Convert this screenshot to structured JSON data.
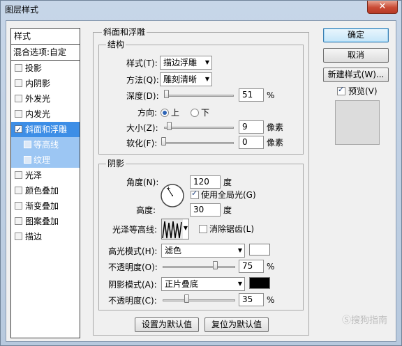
{
  "window": {
    "title": "图层样式",
    "close_glyph": "✕"
  },
  "style_list": {
    "header": "样式",
    "blend_options": "混合选项:自定",
    "items": [
      {
        "label": "投影",
        "checked": false
      },
      {
        "label": "内阴影",
        "checked": false
      },
      {
        "label": "外发光",
        "checked": false
      },
      {
        "label": "内发光",
        "checked": false
      },
      {
        "label": "斜面和浮雕",
        "checked": true,
        "selected": true
      },
      {
        "label": "等高线",
        "checked": false,
        "sub": true
      },
      {
        "label": "纹理",
        "checked": false,
        "sub": true
      },
      {
        "label": "光泽",
        "checked": false
      },
      {
        "label": "颜色叠加",
        "checked": false
      },
      {
        "label": "渐变叠加",
        "checked": false
      },
      {
        "label": "图案叠加",
        "checked": false
      },
      {
        "label": "描边",
        "checked": false
      }
    ]
  },
  "bevel": {
    "title": "斜面和浮雕",
    "structure": {
      "title": "结构",
      "style_label": "样式(T):",
      "style_value": "描边浮雕",
      "technique_label": "方法(Q):",
      "technique_value": "雕刻清晰",
      "depth_label": "深度(D):",
      "depth_value": "51",
      "depth_unit": "%",
      "depth_level": 0.051,
      "direction_label": "方向:",
      "direction_up": "上",
      "direction_down": "下",
      "direction_selected": "上",
      "size_label": "大小(Z):",
      "size_value": "9",
      "size_unit": "像素",
      "soften_label": "软化(F):",
      "soften_value": "0",
      "soften_unit": "像素"
    },
    "shading": {
      "title": "阴影",
      "angle_label": "角度(N):",
      "angle_value": "120",
      "angle_unit": "度",
      "global_light_label": "使用全局光(G)",
      "global_light_checked": true,
      "altitude_label": "高度:",
      "altitude_value": "30",
      "altitude_unit": "度",
      "gloss_contour_label": "光泽等高线:",
      "anti_alias_label": "消除锯齿(L)",
      "anti_alias_checked": false,
      "highlight_mode_label": "高光模式(H):",
      "highlight_mode_value": "滤色",
      "highlight_color": "#ffffff",
      "highlight_opacity_label": "不透明度(O):",
      "highlight_opacity_value": "75",
      "highlight_opacity_unit": "%",
      "shadow_mode_label": "阴影模式(A):",
      "shadow_mode_value": "正片叠底",
      "shadow_color": "#000000",
      "shadow_opacity_label": "不透明度(C):",
      "shadow_opacity_value": "35",
      "shadow_opacity_unit": "%"
    },
    "make_default": "设置为默认值",
    "reset_default": "复位为默认值"
  },
  "actions": {
    "ok": "确定",
    "cancel": "取消",
    "new_style": "新建样式(W)...",
    "preview_label": "预览(V)",
    "preview_checked": true
  },
  "watermark": "Ⓢ搜狗指南"
}
